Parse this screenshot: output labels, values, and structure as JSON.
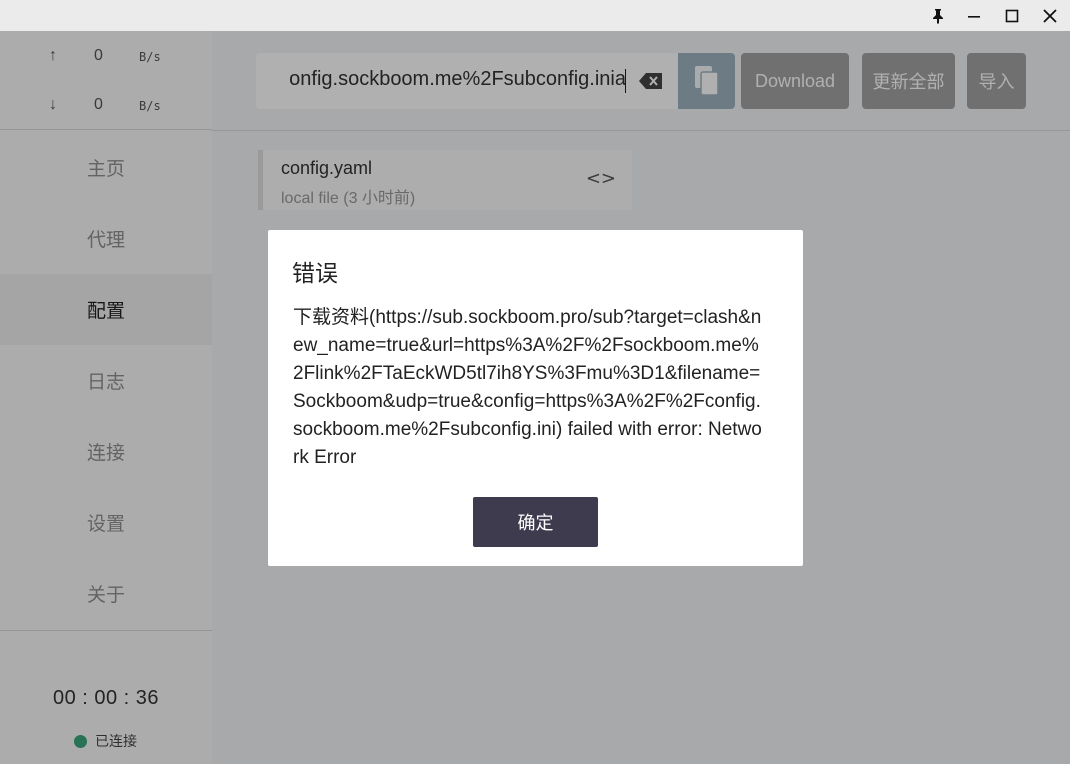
{
  "titlebar": {
    "pin_icon": "pin-icon",
    "minimize_icon": "minimize-icon",
    "maximize_icon": "maximize-icon",
    "close_icon": "close-icon"
  },
  "sidebar": {
    "upload": {
      "arrow": "↑",
      "value": "0",
      "unit": "B/s"
    },
    "download": {
      "arrow": "↓",
      "value": "0",
      "unit": "B/s"
    },
    "nav": [
      {
        "label": "主页",
        "active": false
      },
      {
        "label": "代理",
        "active": false
      },
      {
        "label": "配置",
        "active": true
      },
      {
        "label": "日志",
        "active": false
      },
      {
        "label": "连接",
        "active": false
      },
      {
        "label": "设置",
        "active": false
      },
      {
        "label": "关于",
        "active": false
      }
    ],
    "timer": "00 : 00 : 36",
    "status": {
      "label": "已连接",
      "color": "#3aa57c"
    }
  },
  "toolbar": {
    "url_value": "onfig.sockboom.me%2Fsubconfig.inia",
    "download_label": "Download",
    "update_all_label": "更新全部",
    "import_label": "导入"
  },
  "profiles": [
    {
      "name": "config.yaml",
      "meta": "local file (3 小时前)",
      "edit_glyph": "<>"
    }
  ],
  "dialog": {
    "title": "错误",
    "message": "下载资料(https://sub.sockboom.pro/sub?target=clash&new_name=true&url=https%3A%2F%2Fsockboom.me%2Flink%2FTaEckWD5tl7ih8YS%3Fmu%3D1&filename=Sockboom&udp=true&config=https%3A%2F%2Fconfig.sockboom.me%2Fsubconfig.ini) failed with error: Network Error",
    "confirm_label": "确定"
  },
  "colors": {
    "accent_dark": "#3f3b4f",
    "paste_button": "#9fb3c1",
    "connected": "#3aa57c"
  }
}
